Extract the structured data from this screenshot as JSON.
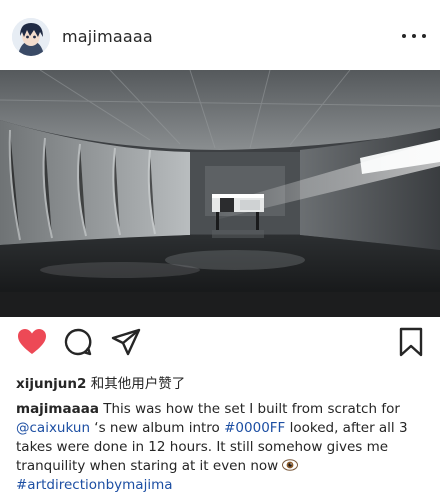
{
  "post": {
    "username": "majimaaaa",
    "caption": {
      "username": "majimaaaa",
      "text_1": " This was how the set I built from scratch for ",
      "mention": "@caixukun",
      "text_2": " ‘s new album intro ",
      "hashtag_1": "#0000FF",
      "text_3": " looked, after all 3 takes were done in 12 hours. It still somehow gives me tranquility when staring at it even now ",
      "hashtag_2": "#artdirectionbymajima"
    },
    "likes": {
      "user": "xijunjun2",
      "suffix": " 和其他用户赞了"
    }
  },
  "colors": {
    "like": "#ed4956",
    "text": "#262626",
    "link": "#1d4fa3"
  },
  "icons": [
    "more-icon",
    "heart-icon",
    "comment-icon",
    "share-icon",
    "bookmark-icon",
    "eye-emoji-icon"
  ]
}
